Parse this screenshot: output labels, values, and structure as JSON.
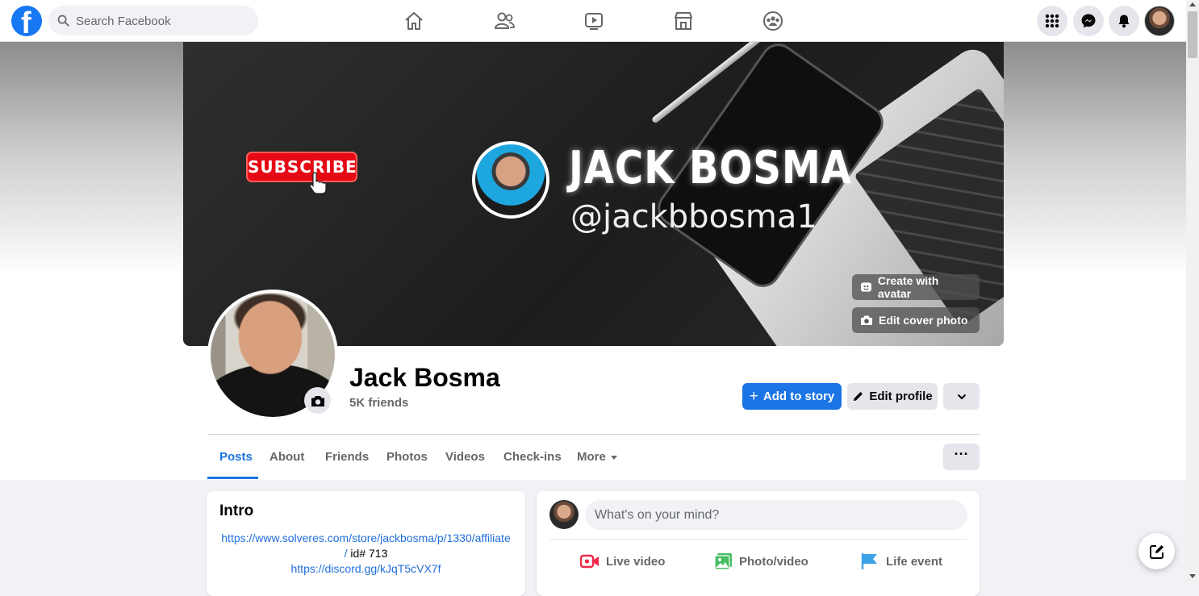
{
  "topbar": {
    "logo_icon": "facebook-logo-icon",
    "search_placeholder": "Search Facebook",
    "nav_icons": [
      "home-icon",
      "friends-icon",
      "watch-icon",
      "marketplace-icon",
      "groups-icon"
    ],
    "right_icons": [
      "menu-grid-icon",
      "messenger-icon",
      "notifications-icon"
    ]
  },
  "cover": {
    "subscribe_label": "SUBSCRIBE",
    "title": "JACK BOSMA",
    "handle": "@jackbbosma1",
    "create_avatar_label": "Create with avatar",
    "edit_cover_label": "Edit cover photo"
  },
  "profile": {
    "name": "Jack Bosma",
    "friends": "5K friends",
    "add_story_label": "Add to story",
    "edit_profile_label": "Edit profile"
  },
  "tabs": [
    {
      "label": "Posts",
      "active": true
    },
    {
      "label": "About"
    },
    {
      "label": "Friends"
    },
    {
      "label": "Photos"
    },
    {
      "label": "Videos"
    },
    {
      "label": "Check-ins"
    },
    {
      "label": "More"
    }
  ],
  "more_options_label": "···",
  "intro": {
    "title": "Intro",
    "link1": "https://www.solveres.com/store/jackbosma/p/1330/affiliate",
    "link1_suffix_link": "/",
    "link1_suffix_text": " id# 713",
    "link2": "https://discord.gg/kJqT5cVX7f"
  },
  "composer": {
    "placeholder": "What's on your mind?",
    "actions": [
      {
        "label": "Live video",
        "icon": "live-video-icon",
        "color": "#f02849"
      },
      {
        "label": "Photo/video",
        "icon": "photo-video-icon",
        "color": "#45bd62"
      },
      {
        "label": "Life event",
        "icon": "life-event-icon",
        "color": "#3ea2e8"
      }
    ]
  },
  "colors": {
    "accent": "#1b74e4",
    "brand": "#1877f2",
    "page_bg": "#f0f2f5"
  }
}
